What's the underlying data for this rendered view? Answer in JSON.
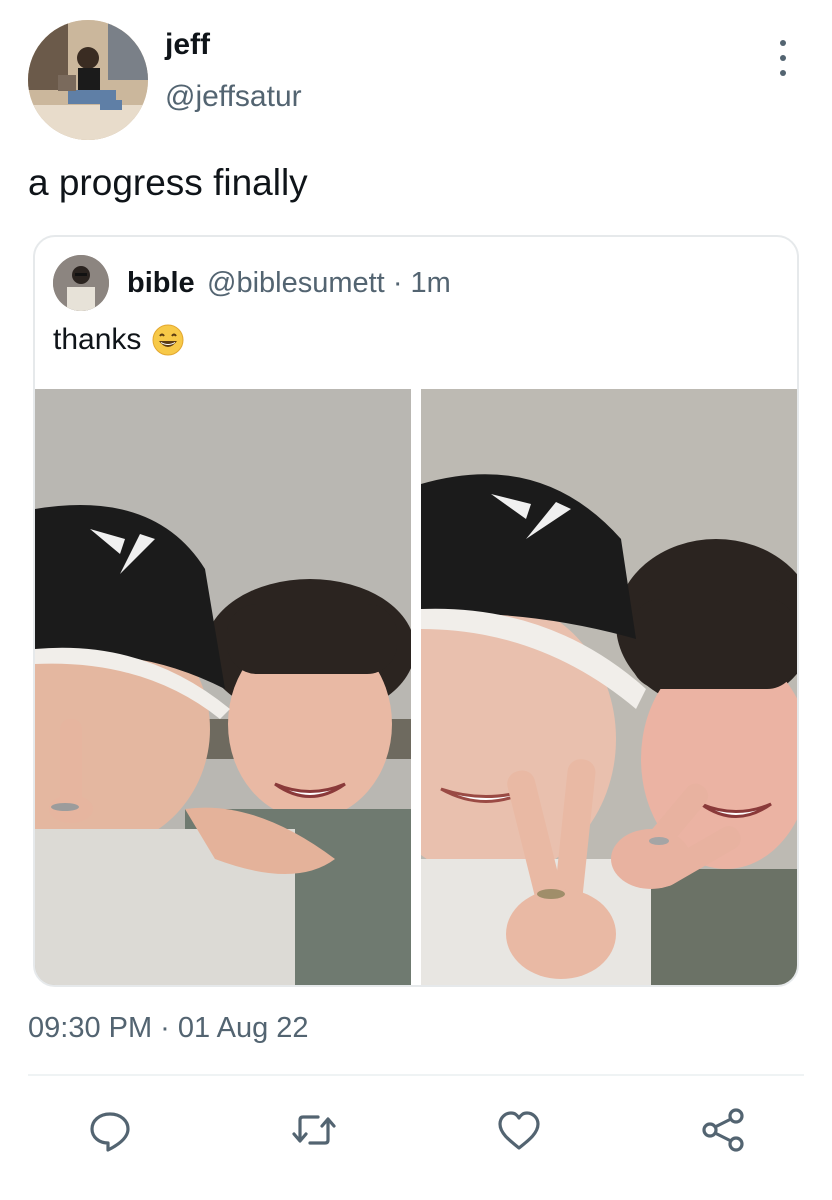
{
  "author": {
    "name": "jeff",
    "handle": "@jeffsatur",
    "avatar_icon": "profile-photo"
  },
  "tweet": {
    "text": "a progress finally"
  },
  "quoted_tweet": {
    "name": "bible",
    "handle": "@biblesumett",
    "separator": "·",
    "time": "1m",
    "text": "thanks",
    "emoji": "grinning-face-emoji",
    "photos": [
      {
        "description_icon": "selfie-photo-1"
      },
      {
        "description_icon": "selfie-photo-2"
      }
    ]
  },
  "timestamp": "09:30 PM · 01 Aug 22",
  "actions": [
    {
      "name": "reply",
      "icon": "reply-icon"
    },
    {
      "name": "retweet",
      "icon": "retweet-icon"
    },
    {
      "name": "like",
      "icon": "heart-icon"
    },
    {
      "name": "share",
      "icon": "share-icon"
    }
  ],
  "colors": {
    "text": "#0f1419",
    "secondary": "#536471",
    "border": "#e6e9eb"
  }
}
